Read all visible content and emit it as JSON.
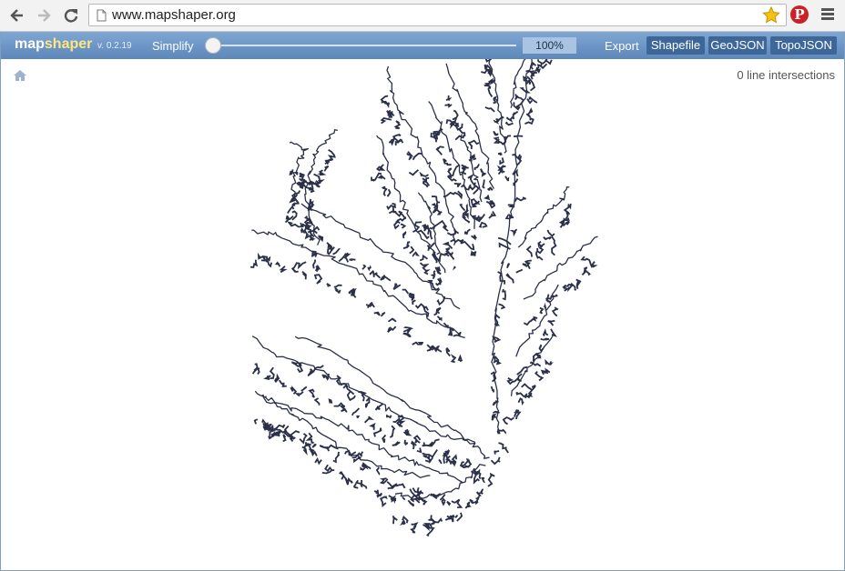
{
  "browser": {
    "url": "www.mapshaper.org",
    "icons": {
      "back": "back-arrow-icon",
      "forward": "forward-arrow-icon",
      "reload": "reload-icon",
      "page": "page-icon",
      "bookmark": "star-icon",
      "extension": "pinterest-icon",
      "menu": "menu-icon"
    }
  },
  "app": {
    "logo_prefix": "map",
    "logo_suffix": "shaper",
    "version": "v. 0.2.19",
    "simplify_label": "Simplify",
    "simplify_pct": "100%",
    "simplify_fraction": 0.0,
    "export_label": "Export",
    "export_buttons": [
      "Shapefile",
      "GeoJSON",
      "TopoJSON"
    ],
    "intersections": "0 line intersections",
    "home_icon": "home-icon"
  },
  "colors": {
    "toolbar_top": "#7fa7d3",
    "toolbar_bottom": "#5d87ba",
    "button_bg": "#3e6799",
    "logo_highlight": "#ffe680",
    "map_stroke": "#2b3049",
    "star": "#f6c20e",
    "pinterest": "#cb2027"
  }
}
